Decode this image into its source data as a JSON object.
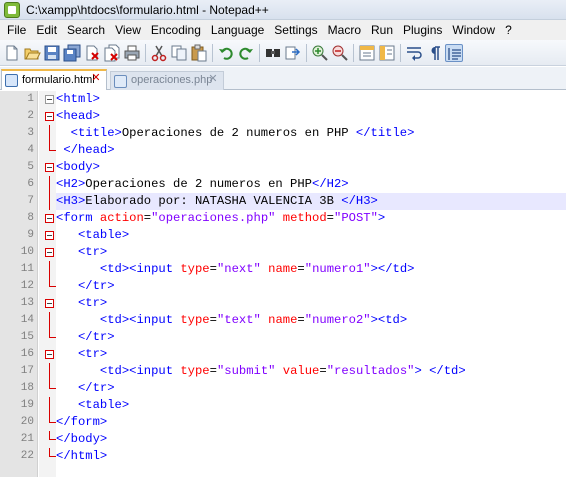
{
  "window": {
    "title": "C:\\xampp\\htdocs\\formulario.html - Notepad++"
  },
  "menu": [
    "File",
    "Edit",
    "Search",
    "View",
    "Encoding",
    "Language",
    "Settings",
    "Macro",
    "Run",
    "Plugins",
    "Window",
    "?"
  ],
  "toolbar": {
    "buttons": [
      "new-file",
      "open-file",
      "save",
      "save-all",
      "close",
      "close-all",
      "print",
      "cut",
      "copy",
      "paste",
      "undo",
      "redo",
      "find",
      "replace",
      "zoom-in",
      "zoom-out",
      "sync-vertical",
      "sync-horizontal",
      "word-wrap",
      "show-all-chars",
      "indent-guide"
    ]
  },
  "tabs": [
    {
      "label": "formulario.html",
      "active": true
    },
    {
      "label": "operaciones.php",
      "active": false
    }
  ],
  "editor": {
    "highlighted_line": 7,
    "lines": [
      {
        "n": "1",
        "indent": "",
        "parts": [
          [
            "tag",
            "<html>"
          ]
        ]
      },
      {
        "n": "2",
        "indent": "",
        "parts": [
          [
            "tag",
            "<head>"
          ]
        ]
      },
      {
        "n": "3",
        "indent": "  ",
        "parts": [
          [
            "tag",
            "<title>"
          ],
          [
            "txt",
            "Operaciones de 2 numeros en PHP "
          ],
          [
            "tag",
            "</title>"
          ]
        ]
      },
      {
        "n": "4",
        "indent": " ",
        "parts": [
          [
            "tag",
            "</head>"
          ]
        ]
      },
      {
        "n": "5",
        "indent": "",
        "parts": [
          [
            "tag",
            "<body>"
          ]
        ]
      },
      {
        "n": "6",
        "indent": "",
        "parts": [
          [
            "tag",
            "<H2>"
          ],
          [
            "txt",
            "Operaciones de 2 numeros en PHP"
          ],
          [
            "tag",
            "</H2>"
          ]
        ]
      },
      {
        "n": "7",
        "indent": "",
        "parts": [
          [
            "tag",
            "<H3>"
          ],
          [
            "txt",
            "Elaborado por: NATASHA VALENCIA 3B "
          ],
          [
            "tag",
            "</H3>"
          ]
        ]
      },
      {
        "n": "8",
        "indent": "",
        "parts": [
          [
            "tag",
            "<form "
          ],
          [
            "attr",
            "action"
          ],
          [
            "txt",
            "="
          ],
          [
            "val",
            "\"operaciones.php\""
          ],
          [
            "txt",
            " "
          ],
          [
            "attr",
            "method"
          ],
          [
            "txt",
            "="
          ],
          [
            "val",
            "\"POST\""
          ],
          [
            "tag",
            ">"
          ]
        ]
      },
      {
        "n": "9",
        "indent": "   ",
        "parts": [
          [
            "tag",
            "<table>"
          ]
        ]
      },
      {
        "n": "10",
        "indent": "   ",
        "parts": [
          [
            "tag",
            "<tr>"
          ]
        ]
      },
      {
        "n": "11",
        "indent": "      ",
        "parts": [
          [
            "tag",
            "<td><input "
          ],
          [
            "attr",
            "type"
          ],
          [
            "txt",
            "="
          ],
          [
            "val",
            "\"next\""
          ],
          [
            "txt",
            " "
          ],
          [
            "attr",
            "name"
          ],
          [
            "txt",
            "="
          ],
          [
            "val",
            "\"numero1\""
          ],
          [
            "tag",
            "></td>"
          ]
        ]
      },
      {
        "n": "12",
        "indent": "   ",
        "parts": [
          [
            "tag",
            "</tr>"
          ]
        ]
      },
      {
        "n": "13",
        "indent": "   ",
        "parts": [
          [
            "tag",
            "<tr>"
          ]
        ]
      },
      {
        "n": "14",
        "indent": "      ",
        "parts": [
          [
            "tag",
            "<td><input "
          ],
          [
            "attr",
            "type"
          ],
          [
            "txt",
            "="
          ],
          [
            "val",
            "\"text\""
          ],
          [
            "txt",
            " "
          ],
          [
            "attr",
            "name"
          ],
          [
            "txt",
            "="
          ],
          [
            "val",
            "\"numero2\""
          ],
          [
            "tag",
            "><td>"
          ]
        ]
      },
      {
        "n": "15",
        "indent": "   ",
        "parts": [
          [
            "tag",
            "</tr>"
          ]
        ]
      },
      {
        "n": "16",
        "indent": "   ",
        "parts": [
          [
            "tag",
            "<tr>"
          ]
        ]
      },
      {
        "n": "17",
        "indent": "      ",
        "parts": [
          [
            "tag",
            "<td><input "
          ],
          [
            "attr",
            "type"
          ],
          [
            "txt",
            "="
          ],
          [
            "val",
            "\"submit\""
          ],
          [
            "txt",
            " "
          ],
          [
            "attr",
            "value"
          ],
          [
            "txt",
            "="
          ],
          [
            "val",
            "\"resultados\""
          ],
          [
            "tag",
            ">"
          ],
          [
            "txt",
            " "
          ],
          [
            "tag",
            "</td>"
          ]
        ]
      },
      {
        "n": "18",
        "indent": "   ",
        "parts": [
          [
            "tag",
            "</tr>"
          ]
        ]
      },
      {
        "n": "19",
        "indent": "   ",
        "parts": [
          [
            "tag",
            "<table>"
          ]
        ]
      },
      {
        "n": "20",
        "indent": "",
        "parts": [
          [
            "tag",
            "</form>"
          ]
        ]
      },
      {
        "n": "21",
        "indent": "",
        "parts": [
          [
            "tag",
            "</body>"
          ]
        ]
      },
      {
        "n": "22",
        "indent": "",
        "parts": [
          [
            "tag",
            "</html>"
          ]
        ]
      }
    ]
  },
  "colors": {
    "tag": "#0000ff",
    "attribute": "#ff0000",
    "value": "#8000ff",
    "text": "#000000",
    "fold_marker": "#d80000",
    "current_line": "#e8e8ff"
  }
}
